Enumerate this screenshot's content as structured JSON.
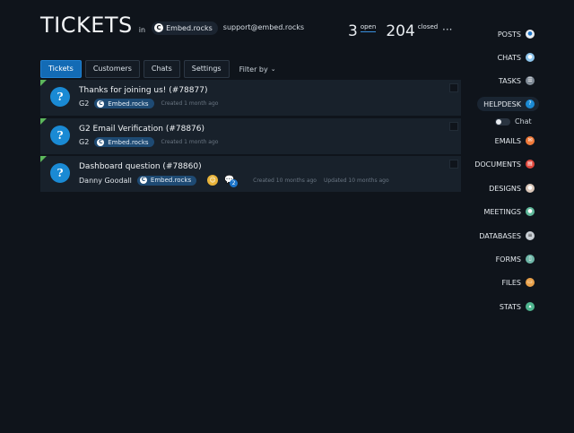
{
  "header": {
    "title": "TICKETS",
    "in_word": "in",
    "site": "Embed.rocks",
    "email": "support@embed.rocks"
  },
  "counts": {
    "open_num": "3",
    "open_label": "open",
    "closed_num": "204",
    "closed_label": "closed",
    "more": "···"
  },
  "tabs": [
    {
      "label": "Tickets",
      "active": true
    },
    {
      "label": "Customers"
    },
    {
      "label": "Chats"
    },
    {
      "label": "Settings"
    }
  ],
  "filter_label": "Filter by",
  "tickets": [
    {
      "title": "Thanks for joining us! (#78877)",
      "user": "G2",
      "site": "Embed.rocks",
      "created": "Created 1 month ago",
      "avatar": "?"
    },
    {
      "title": "G2 Email Verification (#78876)",
      "user": "G2",
      "site": "Embed.rocks",
      "created": "Created 1 month ago",
      "avatar": "?"
    },
    {
      "title": "Dashboard question (#78860)",
      "user": "Danny Goodall",
      "site": "Embed.rocks",
      "chat_count": "2",
      "created": "Created 10 months ago",
      "updated": "Updated 10 months ago",
      "avatar": "?"
    }
  ],
  "nav": {
    "posts": "POSTS",
    "chats": "CHATS",
    "tasks": "TASKS",
    "helpdesk": "HELPDESK",
    "chat_toggle": "Chat",
    "emails": "EMAILS",
    "documents": "DOCUMENTS",
    "designs": "DESIGNS",
    "meetings": "MEETINGS",
    "databases": "DATABASES",
    "forms": "FORMS",
    "files": "FILES",
    "stats": "STATS"
  },
  "colors": {
    "accent": "#136bb5",
    "flag": "#5cb85c",
    "background": "#0f141b",
    "row": "#18212b"
  }
}
